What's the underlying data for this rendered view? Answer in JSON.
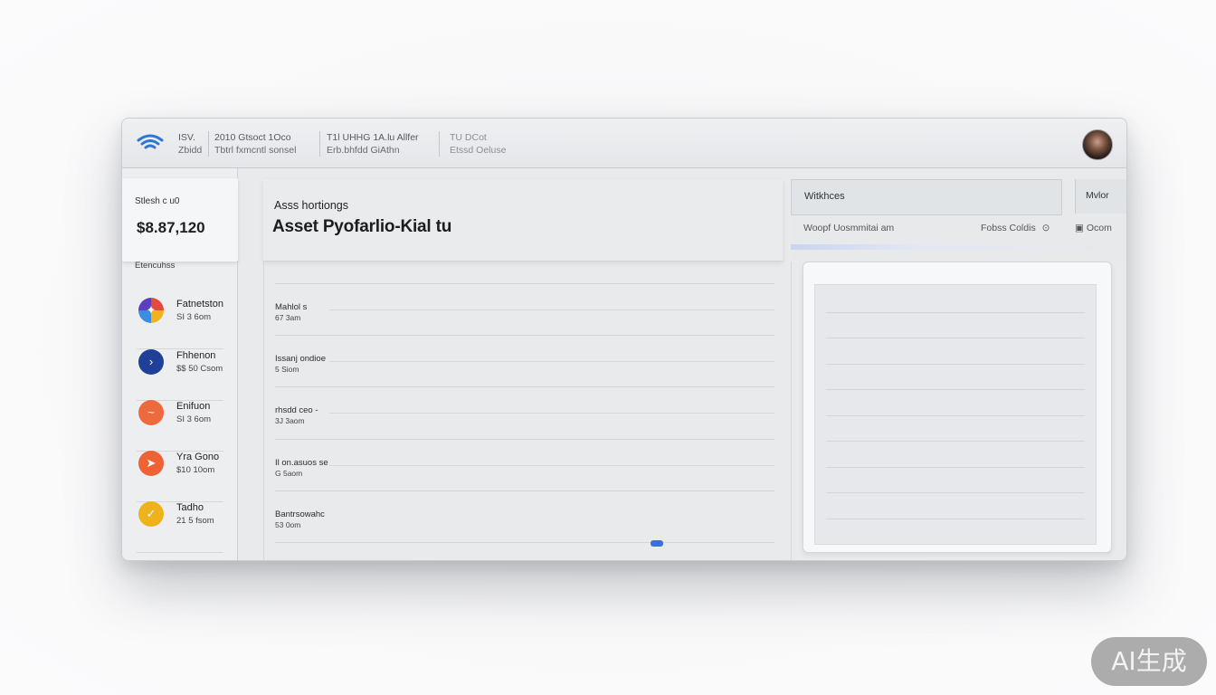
{
  "header": {
    "groups": [
      {
        "line1": "ISV.",
        "line2": "Zbidd"
      },
      {
        "line1": "2010 Gtsoct  1Oco",
        "line2": "Tbtrl fxmcntl sonsel"
      },
      {
        "line1": "T1l UHHG 1A.lu Allfer",
        "line2": "Erb.bhfdd GiAthn"
      },
      {
        "line1": "TU DCot",
        "line2": "Etssd Oeluse"
      }
    ]
  },
  "sidebar": {
    "balance_label": "Stlesh c u0",
    "balance_value": "$8.87,120",
    "section_label": "Etencuhss",
    "items": [
      {
        "name": "Fatnetston",
        "sub": "SI 3 6om",
        "icon": "multicolor-coin-icon",
        "color": "#e24b3b"
      },
      {
        "name": "Fhhenon",
        "sub": "$$ 50 Csom",
        "icon": "chevron-coin-icon",
        "color": "#1f3f98"
      },
      {
        "name": "Enifuon",
        "sub": "SI 3 6om",
        "icon": "swoosh-coin-icon",
        "color": "#ec6a3d"
      },
      {
        "name": "Yra Gono",
        "sub": "$10 10om",
        "icon": "arrow-coin-icon",
        "color": "#ee6236"
      },
      {
        "name": "Tadho",
        "sub": "21 5 fsom",
        "icon": "bolt-coin-icon",
        "color": "#eeb21b"
      }
    ]
  },
  "main": {
    "subtitle": "Asss hortiongs",
    "title": "Asset Pyofarlio-Kial tu",
    "holdings": [
      {
        "name": "Mahlol s",
        "sub": "67 3am"
      },
      {
        "name": "Issanj ondioe",
        "sub": "5 Siom"
      },
      {
        "name": "rhsdd ceo -",
        "sub": "3J 3aom"
      },
      {
        "name": "Il on.asuos se",
        "sub": "G 5aom"
      },
      {
        "name": "Bantrsowahc",
        "sub": "53 0om"
      }
    ]
  },
  "right": {
    "box_label": "Witkhces",
    "box2_label": "Mvlor",
    "row_left": "Woopf Uosmmitai am",
    "row_mid": "Fobss Coldis",
    "row_right": "Ocom"
  },
  "watermark": "AI生成"
}
